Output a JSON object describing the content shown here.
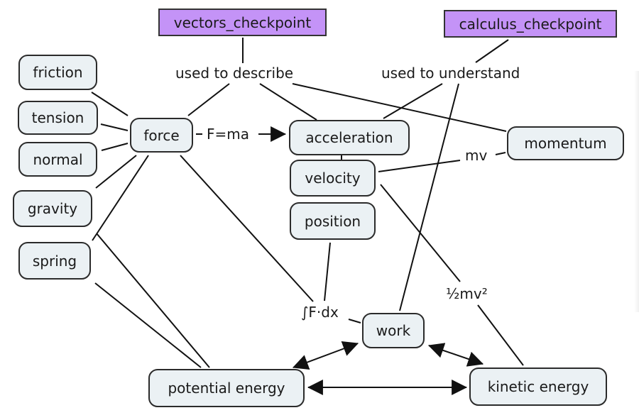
{
  "concept_map": {
    "colors": {
      "concept_fill": "#ebf1f4",
      "concept_border": "#2b2b2b",
      "checkpoint_fill": "#c493f7",
      "line": "#111111"
    },
    "checkpoints": {
      "vectors": "vectors_checkpoint",
      "calculus": "calculus_checkpoint"
    },
    "concepts": {
      "friction": "friction",
      "tension": "tension",
      "normal": "normal",
      "gravity": "gravity",
      "spring": "spring",
      "force": "force",
      "acceleration": "acceleration",
      "velocity": "velocity",
      "position": "position",
      "momentum": "momentum",
      "work": "work",
      "potential_energy": "potential energy",
      "kinetic_energy": "kinetic energy"
    },
    "link_labels": {
      "used_to_describe": "used to describe",
      "used_to_understand": "used to understand",
      "f_ma": "F=ma",
      "mv": "mv",
      "integral_f_dx": "∫F·dx",
      "half_mv2": "½mv²"
    },
    "connections": [
      {
        "from": "friction",
        "to": "force"
      },
      {
        "from": "tension",
        "to": "force"
      },
      {
        "from": "normal",
        "to": "force"
      },
      {
        "from": "gravity",
        "to": "force"
      },
      {
        "from": "force",
        "to": "potential energy"
      },
      {
        "from": "gravity",
        "to": "potential energy"
      },
      {
        "from": "spring",
        "to": "potential energy"
      },
      {
        "from": "vectors_checkpoint",
        "via": "used to describe",
        "to": [
          "force",
          "acceleration",
          "momentum"
        ]
      },
      {
        "from": "calculus_checkpoint",
        "via": "used to understand",
        "to": [
          "acceleration",
          "work"
        ]
      },
      {
        "from": "force",
        "via": "F=ma",
        "to": "acceleration",
        "arrow": true
      },
      {
        "from": "acceleration",
        "to": "velocity"
      },
      {
        "from": "velocity",
        "to": "position"
      },
      {
        "from": "velocity",
        "via": "mv",
        "to": "momentum"
      },
      {
        "from": "force",
        "via": "∫F·dx",
        "to": "work"
      },
      {
        "from": "position",
        "via": "∫F·dx",
        "to": "work"
      },
      {
        "from": "velocity",
        "via": "½mv²",
        "to": "kinetic energy"
      },
      {
        "from": "work",
        "to": "potential energy",
        "arrow": "both"
      },
      {
        "from": "work",
        "to": "kinetic energy",
        "arrow": "both"
      },
      {
        "from": "potential energy",
        "to": "kinetic energy",
        "arrow": "both"
      }
    ]
  }
}
